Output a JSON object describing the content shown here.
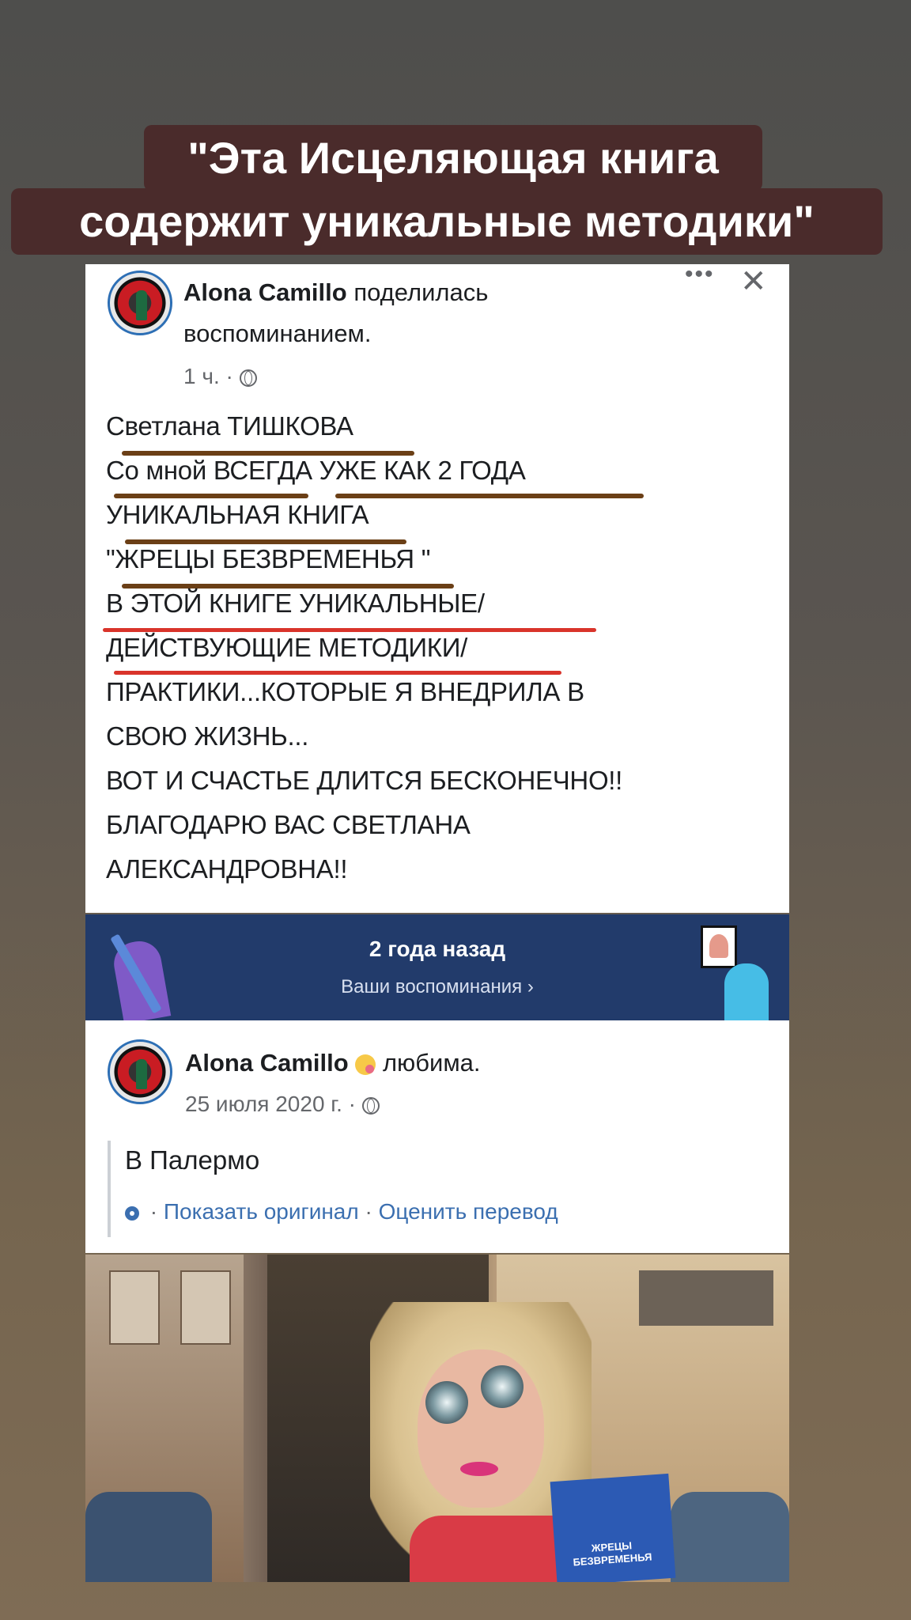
{
  "story_caption": {
    "line1": "\"Эта Исцеляющая книга",
    "line2": "содержит уникальные методики\""
  },
  "shared_post": {
    "author": "Alona Camillo",
    "action": "поделилась",
    "action_line2": "воспоминанием.",
    "time": "1 ч. ·",
    "more_icon": "more-icon",
    "close_icon": "close-icon",
    "body_lines": [
      "Светлана ТИШКОВА",
      "Со мной ВСЕГДА  УЖЕ КАК 2 ГОДА",
      "УНИКАЛЬНАЯ КНИГА",
      "\"ЖРЕЦЫ БЕЗВРЕМЕНЬЯ \"",
      "В ЭТОЙ КНИГЕ УНИКАЛЬНЫЕ/",
      "ДЕЙСТВУЮЩИЕ МЕТОДИКИ/",
      "ПРАКТИКИ...КОТОРЫЕ Я ВНЕДРИЛА В",
      "СВОЮ ЖИЗНЬ...",
      "ВОТ И СЧАСТЬЕ ДЛИТСЯ БЕСКОНЕЧНО!!",
      "БЛАГОДАРЮ ВАС СВЕТЛАНА",
      "АЛЕКСАНДРОВНА!!"
    ],
    "underline_colors": {
      "brown": "#6b3f16",
      "red": "#d9342b"
    }
  },
  "memories_banner": {
    "title": "2 года назад",
    "link": "Ваши воспоминания ›",
    "background": "#223b6b"
  },
  "original_post": {
    "author": "Alona Camillo",
    "feeling": "любима.",
    "date": "25 июля 2020 г. ·",
    "text": "В Палермо",
    "show_original": "Показать оригинал",
    "rate_translation": "Оценить перевод",
    "separator": " · "
  },
  "photo": {
    "book_title_line1": "ЖРЕЦЫ",
    "book_title_line2": "БЕЗВРЕМЕНЬЯ"
  },
  "colors": {
    "caption_bg": "#4a2b2b",
    "link_blue": "#3b6fb0",
    "avatar_border": "#2d6fb5"
  }
}
